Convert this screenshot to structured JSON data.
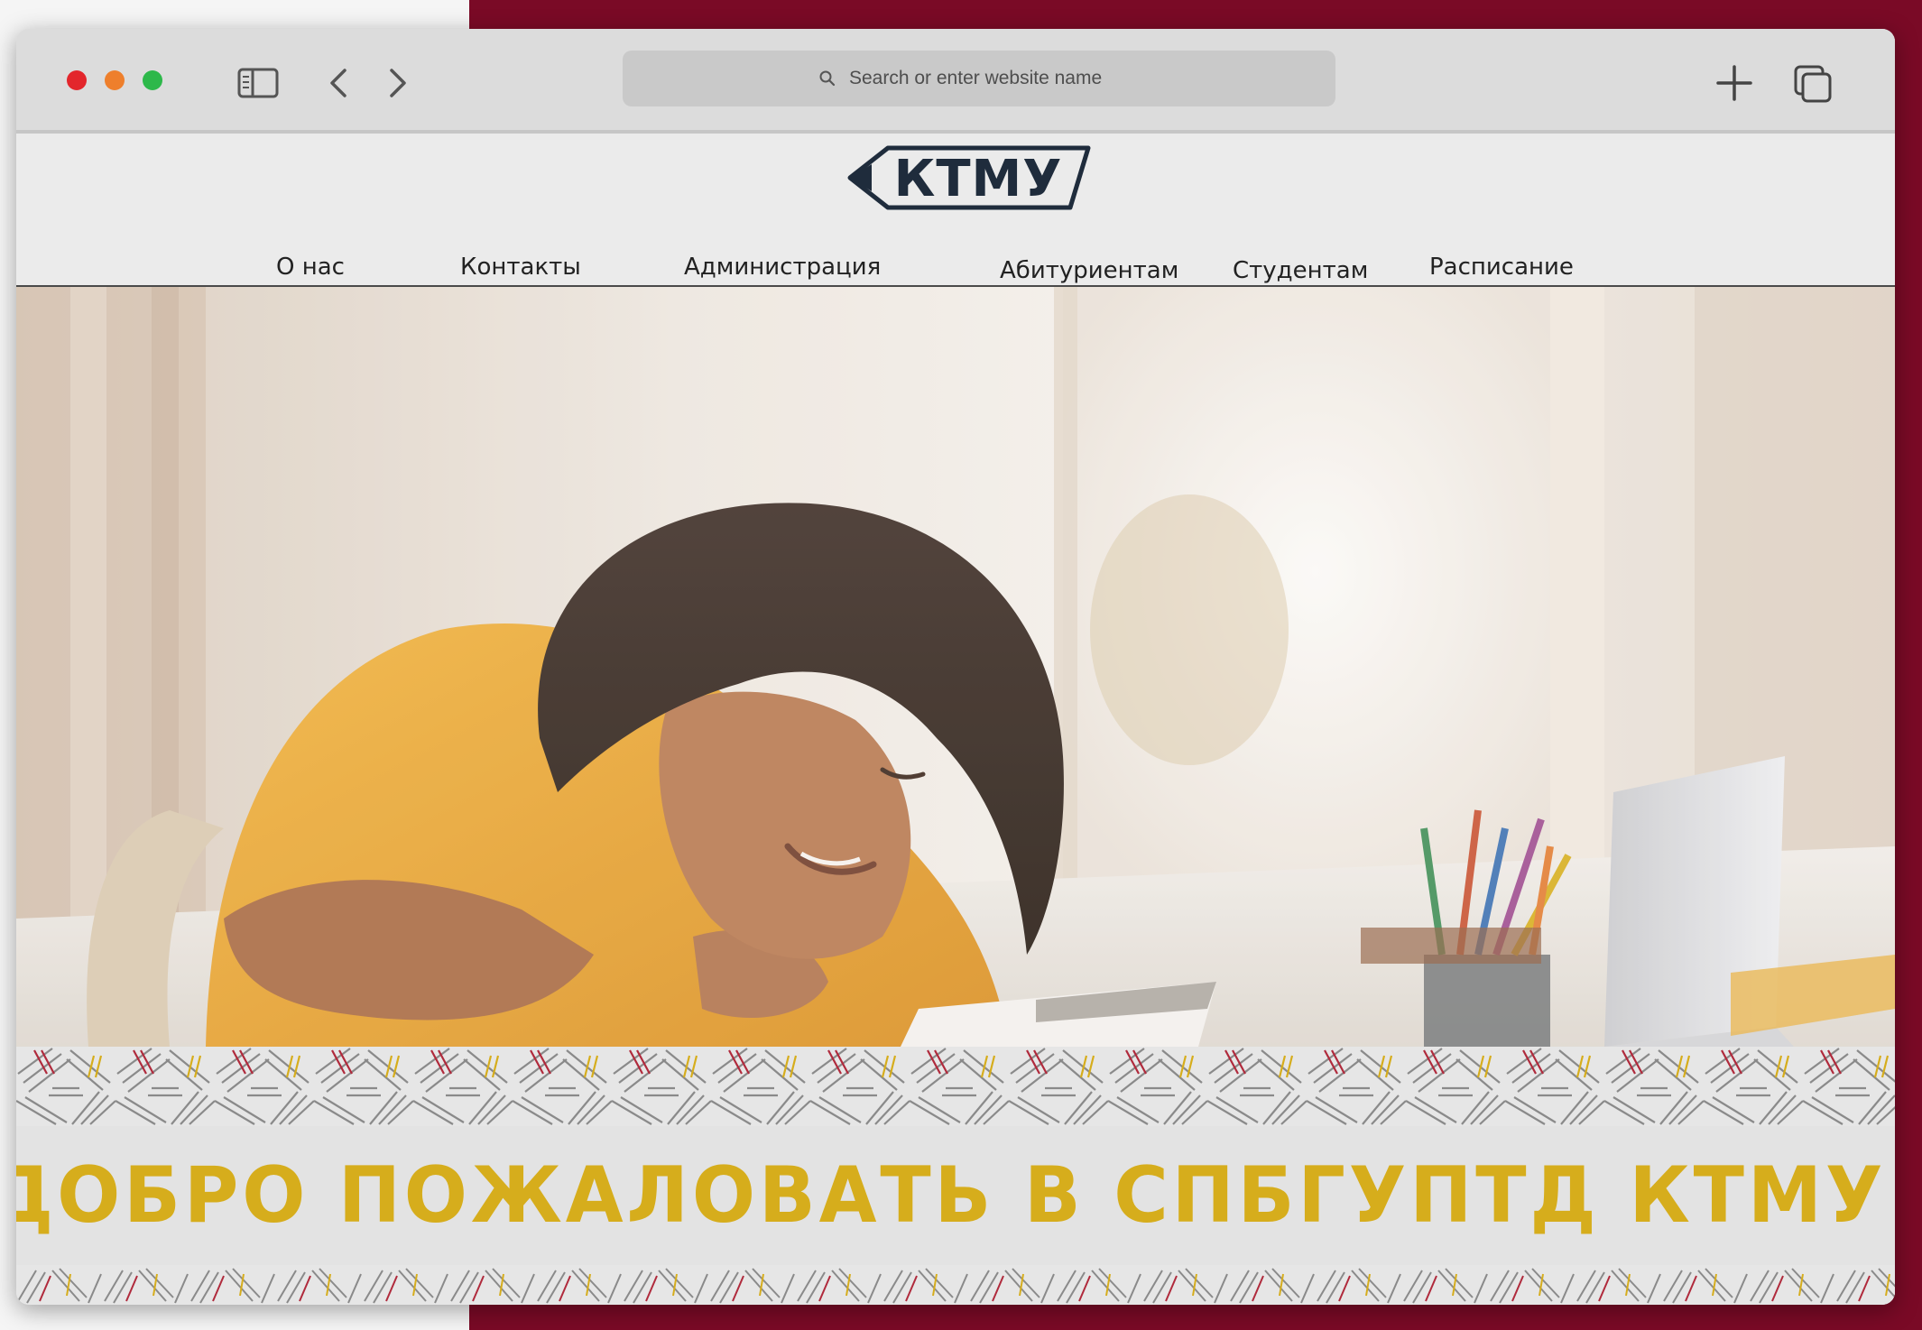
{
  "browser": {
    "address_placeholder": "Search or enter website name",
    "window_buttons": [
      "close",
      "minimize",
      "zoom"
    ],
    "toolbar_icons": [
      "sidebar-icon",
      "back-icon",
      "forward-icon",
      "new-tab-icon",
      "tabs-overview-icon"
    ]
  },
  "site": {
    "logo_text": "КТМУ",
    "nav": [
      {
        "label": "О нас"
      },
      {
        "label": "Контакты"
      },
      {
        "label": "Администрация"
      },
      {
        "label": "Абитуриентам"
      },
      {
        "label": "Студентам"
      },
      {
        "label": "Расписание"
      }
    ],
    "welcome": "ДОБРО ПОЖАЛОВАТЬ В СПБГУПТД КТМУ!"
  },
  "colors": {
    "frame_accent": "#7a0a26",
    "welcome_text": "#d6ad1c",
    "logo_ink": "#1f2c3c",
    "pattern_lines": "#8a8a8a",
    "pattern_red": "#b02a3c",
    "pattern_gold": "#d6ad1c"
  }
}
